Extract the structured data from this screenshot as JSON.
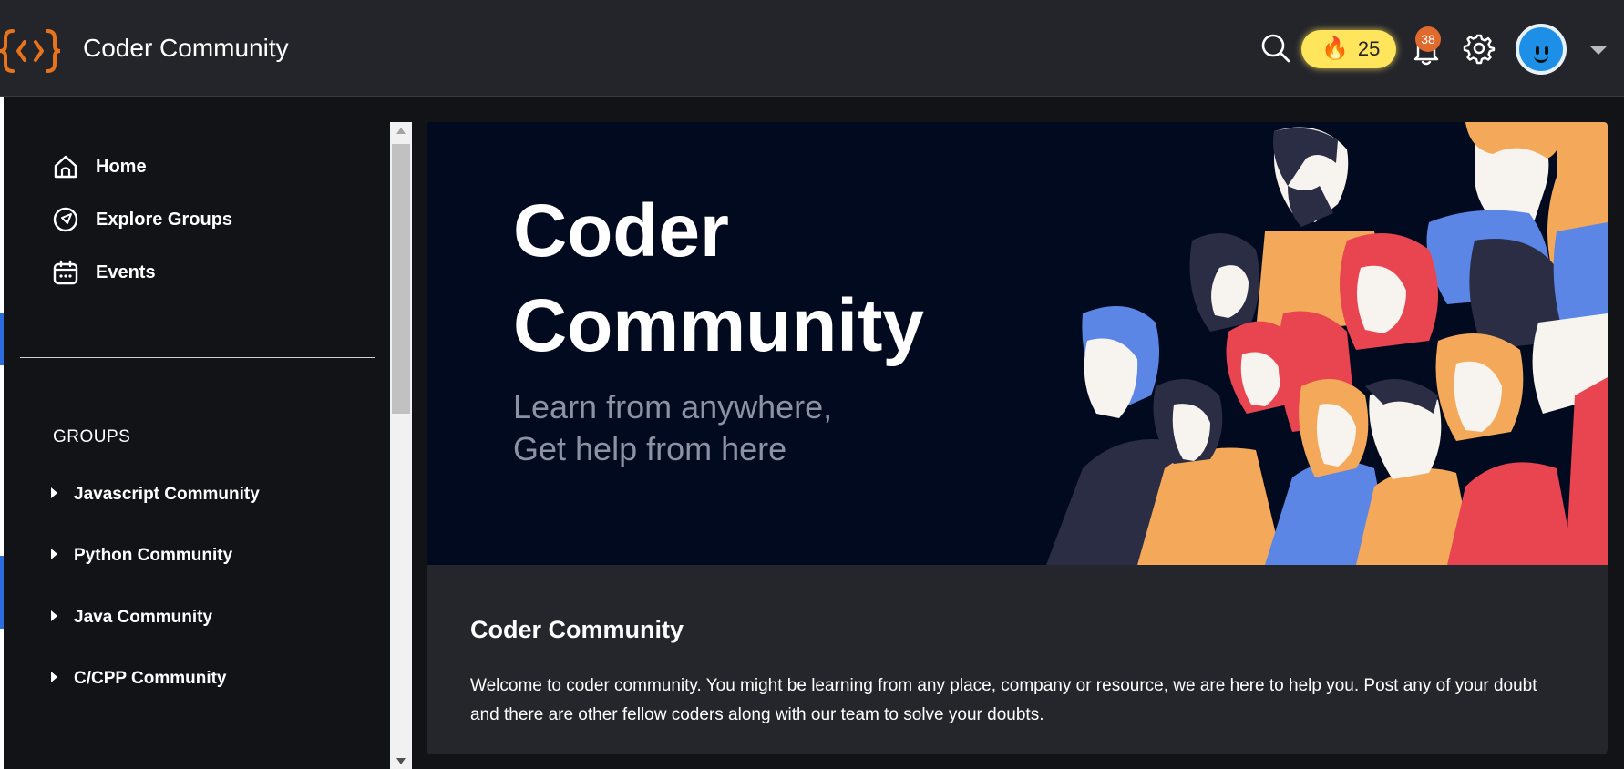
{
  "header": {
    "title": "Coder Community",
    "streak_count": "25",
    "notification_count": "38"
  },
  "sidebar": {
    "nav": [
      {
        "label": "Home",
        "icon": "home-icon"
      },
      {
        "label": "Explore Groups",
        "icon": "compass-icon"
      },
      {
        "label": "Events",
        "icon": "calendar-icon"
      }
    ],
    "groups_header": "GROUPS",
    "groups": [
      {
        "label": "Javascript Community"
      },
      {
        "label": "Python Community"
      },
      {
        "label": "Java Community"
      },
      {
        "label": "C/CPP Community"
      }
    ]
  },
  "banner": {
    "title_line1": "Coder",
    "title_line2": "Community",
    "subtitle_line1": "Learn from anywhere,",
    "subtitle_line2": "Get help from here"
  },
  "card": {
    "title": "Coder Community",
    "body": "Welcome to coder community. You might be learning from any place, company or resource, we are here to help you. Post any of your doubt and there are other fellow coders along with our team to solve your doubts."
  },
  "colors": {
    "topbar": "#24252b",
    "background": "#121317",
    "card": "#25262c",
    "accent_orange": "#e8731a",
    "streak_yellow": "#ffe55c",
    "badge_orange": "#e0692d",
    "banner_bg": "#020a1f"
  }
}
